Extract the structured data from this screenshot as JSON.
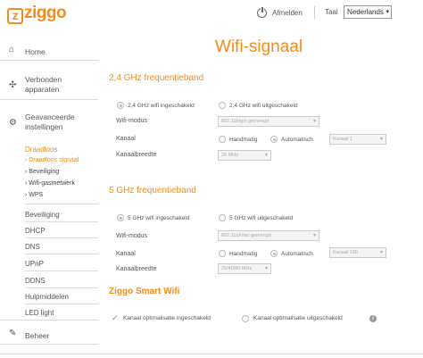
{
  "header": {
    "logo": "ziggo",
    "logout_label": "Afmelden",
    "language_label": "Taal",
    "language_value": "Nederlands"
  },
  "sidebar": {
    "home": "Home",
    "connected_devices": "Verbonden apparaten",
    "advanced_settings": "Geavanceerde instellingen",
    "wireless": "Draadloos",
    "wireless_items": [
      "Draadloos signaal",
      "Beveiliging",
      "Wifi-gastnetwerk",
      "WPS"
    ],
    "items": [
      "Beveiliging",
      "DHCP",
      "DNS",
      "UPnP",
      "DDNS",
      "Hulpmiddelen",
      "LED light"
    ],
    "manage": "Beheer"
  },
  "main": {
    "title": "Wifi-signaal",
    "band24": {
      "title": "2,4 GHz frequentieband",
      "on_label": "2,4 GHz wifi ingeschakeld",
      "off_label": "2,4 GHz wifi uitgeschakeld",
      "mode_label": "Wifi-modus",
      "mode_value": "802.11b/g/n gemengd",
      "channel_label": "Kanaal",
      "manual_label": "Handmatig",
      "auto_label": "Automatisch",
      "channel_value": "Kanaal 1",
      "bandwidth_label": "Kanaalbreedte",
      "bandwidth_value": "20 MHz"
    },
    "band5": {
      "title": "5 GHz frequentieband",
      "on_label": "5 GHz wifi ingeschakeld",
      "off_label": "5 GHz wifi uitgeschakeld",
      "mode_label": "Wifi-modus",
      "mode_value": "802.11a/n/ac gemengd",
      "channel_label": "Kanaal",
      "manual_label": "Handmatig",
      "auto_label": "Automatisch",
      "channel_value": "Kanaal 100",
      "bandwidth_label": "Kanaalbreedte",
      "bandwidth_value": "20/40/80 MHz"
    },
    "smart_wifi": {
      "title": "Ziggo Smart Wifi",
      "on_label": "Kanaal optimalisatie ingeschakeld",
      "off_label": "Kanaal optimalisatie uitgeschakeld",
      "info_glyph": "i"
    }
  }
}
